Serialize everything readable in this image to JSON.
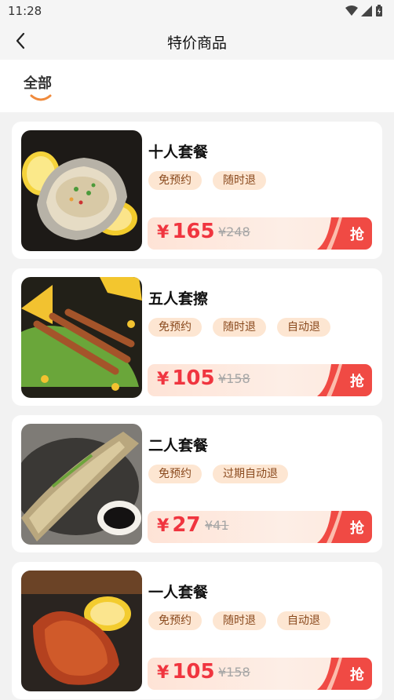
{
  "status_bar": {
    "time": "11:28"
  },
  "nav": {
    "title": "特价商品"
  },
  "tabs": [
    {
      "label": "全部"
    }
  ],
  "colors": {
    "accent": "#f0353f",
    "tag_bg": "#fde6d2",
    "tab_underline": "#f08a3c"
  },
  "products": [
    {
      "title": "十人套餐",
      "tags": [
        "免预约",
        "随时退"
      ],
      "price_symbol": "¥",
      "price": "165",
      "original_price": "¥248",
      "button": "抢",
      "image": "oyster"
    },
    {
      "title": "五人套擦",
      "tags": [
        "免预约",
        "随时退",
        "自动退"
      ],
      "price_symbol": "¥",
      "price": "105",
      "original_price": "¥158",
      "button": "抢",
      "image": "skewers"
    },
    {
      "title": "二人套餐",
      "tags": [
        "免预约",
        "过期自动退"
      ],
      "price_symbol": "¥",
      "price": "27",
      "original_price": "¥41",
      "button": "抢",
      "image": "grilled-fish"
    },
    {
      "title": "一人套餐",
      "tags": [
        "免预约",
        "随时退",
        "自动退"
      ],
      "price_symbol": "¥",
      "price": "105",
      "original_price": "¥158",
      "button": "抢",
      "image": "chicken-wing"
    }
  ]
}
